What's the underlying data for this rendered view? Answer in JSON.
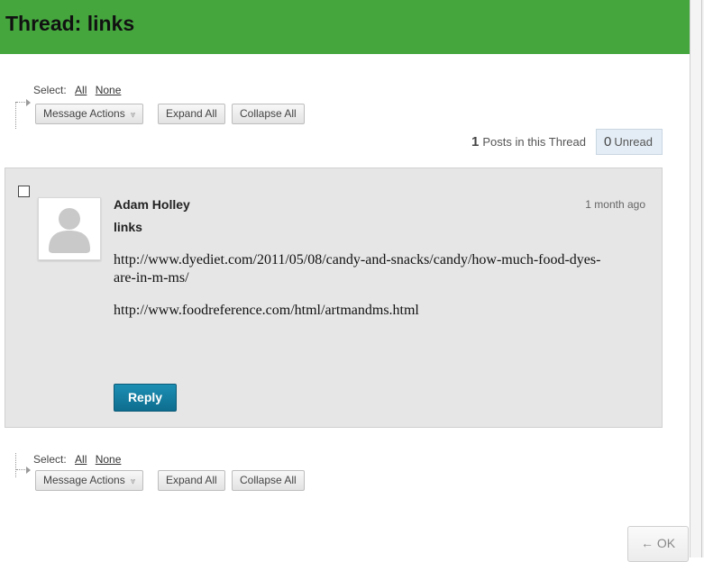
{
  "header": {
    "title": "Thread: links"
  },
  "toolbar": {
    "select_label": "Select:",
    "all_link": "All",
    "none_link": "None",
    "message_actions": "Message Actions",
    "expand_all": "Expand All",
    "collapse_all": "Collapse All"
  },
  "thread_stats": {
    "posts_count": "1",
    "posts_label": "Posts in this Thread",
    "unread_count": "0",
    "unread_label": "Unread"
  },
  "post": {
    "author": "Adam Holley",
    "time": "1 month ago",
    "subject": "links",
    "body": [
      "http://www.dyediet.com/2011/05/08/candy-and-snacks/candy/how-much-food-dyes-are-in-m-ms/",
      "http://www.foodreference.com/html/artmandms.html"
    ],
    "reply_label": "Reply"
  },
  "footer": {
    "ok_label": "← OK"
  },
  "colors": {
    "header_bg": "#45a63e",
    "reply_bg": "#0e6d8f",
    "post_bg": "#e6e6e6"
  }
}
